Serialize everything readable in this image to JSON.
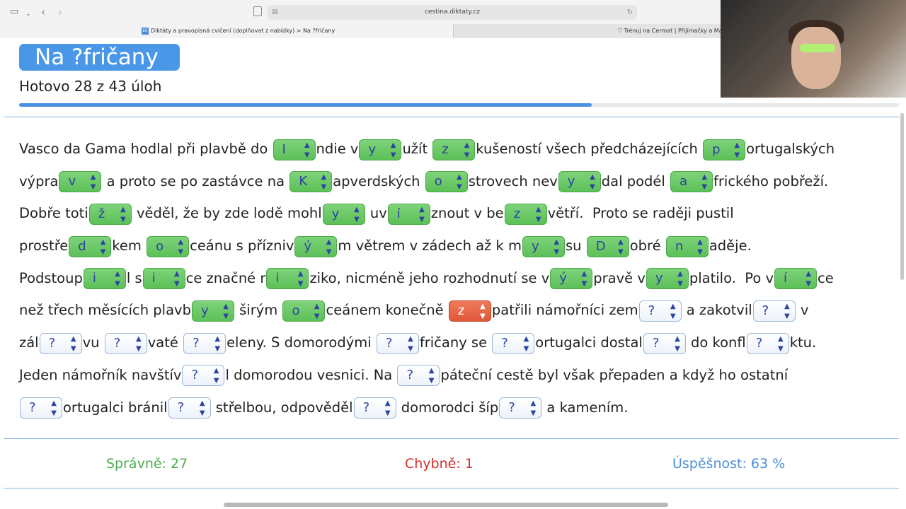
{
  "browser": {
    "url": "cestina.diktaty.cz",
    "tab_active": "Diktáty a pravopisná cvičení (doplňovat z nabídky) > Na ?fričany",
    "tab_inactive": "Trénuj na Cermat | Přijímačky a Maturi",
    "tab_active_favicon": "LV"
  },
  "page": {
    "title": "Na ?fričany",
    "progress_text": "Hotovo 28 z 43 úloh",
    "progress_done": 28,
    "progress_total": 43
  },
  "lines": [
    [
      {
        "t": "Vasco da Gama hodlal při plavbě do "
      },
      {
        "s": "I",
        "st": "correct"
      },
      {
        "t": "ndie v"
      },
      {
        "s": "y",
        "st": "correct"
      },
      {
        "t": "užít "
      },
      {
        "s": "z",
        "st": "correct"
      },
      {
        "t": "kušeností všech předcházejících "
      },
      {
        "s": "p",
        "st": "correct"
      },
      {
        "t": "ortugalských"
      }
    ],
    [
      {
        "t": "výpra"
      },
      {
        "s": "v",
        "st": "correct"
      },
      {
        "t": " a proto se po zastávce na "
      },
      {
        "s": "K",
        "st": "correct"
      },
      {
        "t": "apverdských "
      },
      {
        "s": "o",
        "st": "correct"
      },
      {
        "t": "strovech nev"
      },
      {
        "s": "y",
        "st": "correct"
      },
      {
        "t": "dal podél "
      },
      {
        "s": "a",
        "st": "correct"
      },
      {
        "t": "frického pobřeží."
      }
    ],
    [
      {
        "t": "Dobře toti"
      },
      {
        "s": "ž",
        "st": "correct"
      },
      {
        "t": " věděl, že by zde lodě mohl"
      },
      {
        "s": "y",
        "st": "correct"
      },
      {
        "t": " uv"
      },
      {
        "s": "í",
        "st": "correct"
      },
      {
        "t": "znout v be"
      },
      {
        "s": "z",
        "st": "correct"
      },
      {
        "t": "větří.  Proto se raději pustil"
      }
    ],
    [
      {
        "t": "prostře"
      },
      {
        "s": "d",
        "st": "correct"
      },
      {
        "t": "kem "
      },
      {
        "s": "o",
        "st": "correct"
      },
      {
        "t": "ceánu s přízniv"
      },
      {
        "s": "ý",
        "st": "correct"
      },
      {
        "t": "m větrem v zádech až k m"
      },
      {
        "s": "y",
        "st": "correct"
      },
      {
        "t": "su "
      },
      {
        "s": "D",
        "st": "correct"
      },
      {
        "t": "obré "
      },
      {
        "s": "n",
        "st": "correct"
      },
      {
        "t": "aděje."
      }
    ],
    [
      {
        "t": "Podstoup"
      },
      {
        "s": "i",
        "st": "correct"
      },
      {
        "t": "l s"
      },
      {
        "s": "i",
        "st": "correct"
      },
      {
        "t": "ce značné r"
      },
      {
        "s": "i",
        "st": "correct"
      },
      {
        "t": "ziko, nicméně jeho rozhodnutí se v"
      },
      {
        "s": "ý",
        "st": "correct"
      },
      {
        "t": "pravě v"
      },
      {
        "s": "y",
        "st": "correct"
      },
      {
        "t": "platilo.  Po v"
      },
      {
        "s": "í",
        "st": "correct"
      },
      {
        "t": "ce"
      }
    ],
    [
      {
        "t": "než třech měsících plavb"
      },
      {
        "s": "y",
        "st": "correct"
      },
      {
        "t": " širým "
      },
      {
        "s": "o",
        "st": "correct"
      },
      {
        "t": "ceánem konečně "
      },
      {
        "s": "z",
        "st": "wrong"
      },
      {
        "t": "patřili námořníci zem"
      },
      {
        "s": "?",
        "st": "empty"
      },
      {
        "t": " a zakotvil"
      },
      {
        "s": "?",
        "st": "empty"
      },
      {
        "t": " v"
      }
    ],
    [
      {
        "t": "zál"
      },
      {
        "s": "?",
        "st": "empty"
      },
      {
        "t": "vu "
      },
      {
        "s": "?",
        "st": "empty"
      },
      {
        "t": "vaté "
      },
      {
        "s": "?",
        "st": "empty"
      },
      {
        "t": "eleny. S domorodými "
      },
      {
        "s": "?",
        "st": "empty"
      },
      {
        "t": "fričany se "
      },
      {
        "s": "?",
        "st": "empty"
      },
      {
        "t": "ortugalci dostal"
      },
      {
        "s": "?",
        "st": "empty"
      },
      {
        "t": " do konfl"
      },
      {
        "s": "?",
        "st": "empty"
      },
      {
        "t": "ktu."
      }
    ],
    [
      {
        "t": "Jeden námořník navštív"
      },
      {
        "s": "?",
        "st": "empty"
      },
      {
        "t": "l domorodou vesnici. Na "
      },
      {
        "s": "?",
        "st": "empty"
      },
      {
        "t": "páteční cestě byl však přepaden a když ho ostatní"
      }
    ],
    [
      {
        "s": "?",
        "st": "empty"
      },
      {
        "t": "ortugalci bránil"
      },
      {
        "s": "?",
        "st": "empty"
      },
      {
        "t": " střelbou, odpověděl"
      },
      {
        "s": "?",
        "st": "empty"
      },
      {
        "t": " domorodci šíp"
      },
      {
        "s": "?",
        "st": "empty"
      },
      {
        "t": " a kamením."
      }
    ]
  ],
  "stats": {
    "correct": "Správně: 27",
    "wrong": "Chybně: 1",
    "rate": "Úspěšnost: 63 %"
  },
  "colors": {
    "accent": "#4a97e8",
    "correct": "#5cc058",
    "wrong": "#e0573a",
    "stat_ok": "#4caf50",
    "stat_err": "#d32f2f",
    "stat_rate": "#4a90d9"
  }
}
